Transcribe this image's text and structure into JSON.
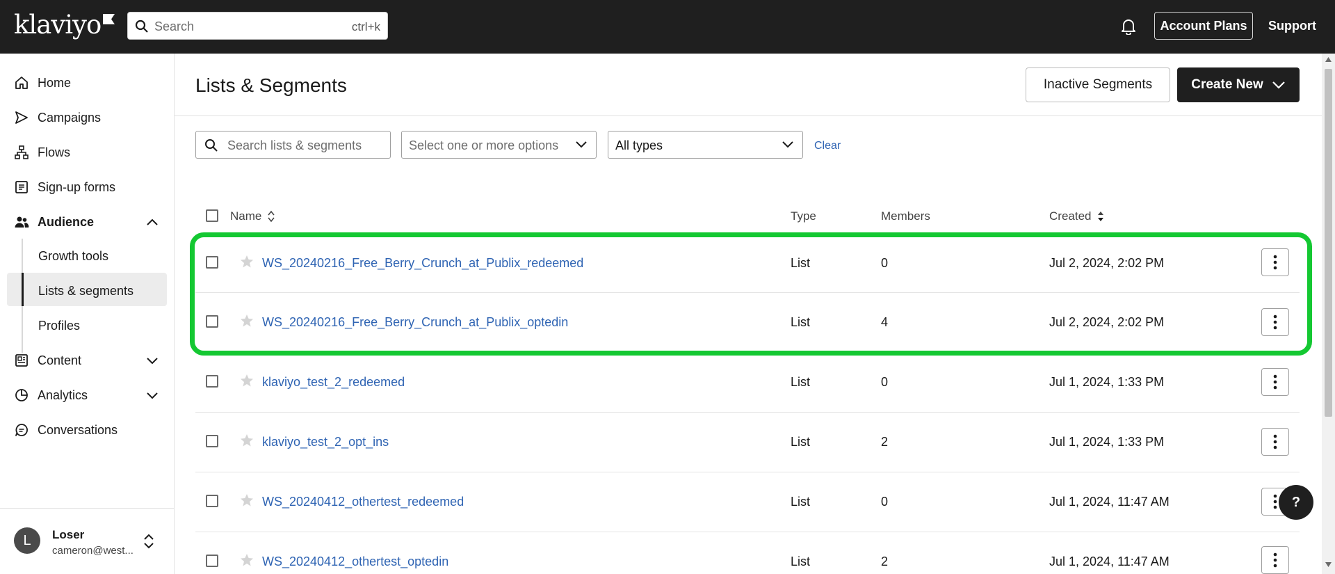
{
  "topbar": {
    "logo": "klaviyo",
    "search_placeholder": "Search",
    "search_shortcut": "ctrl+k",
    "account_plans": "Account Plans",
    "support": "Support"
  },
  "sidebar": {
    "items": [
      {
        "label": "Home",
        "icon": "home-icon"
      },
      {
        "label": "Campaigns",
        "icon": "send-icon"
      },
      {
        "label": "Flows",
        "icon": "flow-icon"
      },
      {
        "label": "Sign-up forms",
        "icon": "form-icon"
      },
      {
        "label": "Audience",
        "icon": "people-icon"
      },
      {
        "label": "Content",
        "icon": "content-icon"
      },
      {
        "label": "Analytics",
        "icon": "pie-chart-icon"
      },
      {
        "label": "Conversations",
        "icon": "chat-icon"
      }
    ],
    "audience_sub": [
      "Growth tools",
      "Lists & segments",
      "Profiles"
    ],
    "profile": {
      "initial": "L",
      "name": "Loser",
      "email": "cameron@west..."
    }
  },
  "main": {
    "title": "Lists & Segments",
    "inactive_segments": "Inactive Segments",
    "create_new": "Create New",
    "filters": {
      "search_placeholder": "Search lists & segments",
      "tags_placeholder": "Select one or more options",
      "type_value": "All types",
      "clear": "Clear"
    },
    "columns": {
      "name": "Name",
      "type": "Type",
      "members": "Members",
      "created": "Created"
    },
    "rows": [
      {
        "name": "WS_20240216_Free_Berry_Crunch_at_Publix_redeemed",
        "type": "List",
        "members": "0",
        "created": "Jul 2, 2024, 2:02 PM"
      },
      {
        "name": "WS_20240216_Free_Berry_Crunch_at_Publix_optedin",
        "type": "List",
        "members": "4",
        "created": "Jul 2, 2024, 2:02 PM"
      },
      {
        "name": "klaviyo_test_2_redeemed",
        "type": "List",
        "members": "0",
        "created": "Jul 1, 2024, 1:33 PM"
      },
      {
        "name": "klaviyo_test_2_opt_ins",
        "type": "List",
        "members": "2",
        "created": "Jul 1, 2024, 1:33 PM"
      },
      {
        "name": "WS_20240412_othertest_redeemed",
        "type": "List",
        "members": "0",
        "created": "Jul 1, 2024, 11:47 AM"
      },
      {
        "name": "WS_20240412_othertest_optedin",
        "type": "List",
        "members": "2",
        "created": "Jul 1, 2024, 11:47 AM"
      }
    ]
  },
  "help": "?",
  "colors": {
    "topbar": "#1f1f1f",
    "link": "#2f64b3",
    "highlight": "#14c832"
  }
}
